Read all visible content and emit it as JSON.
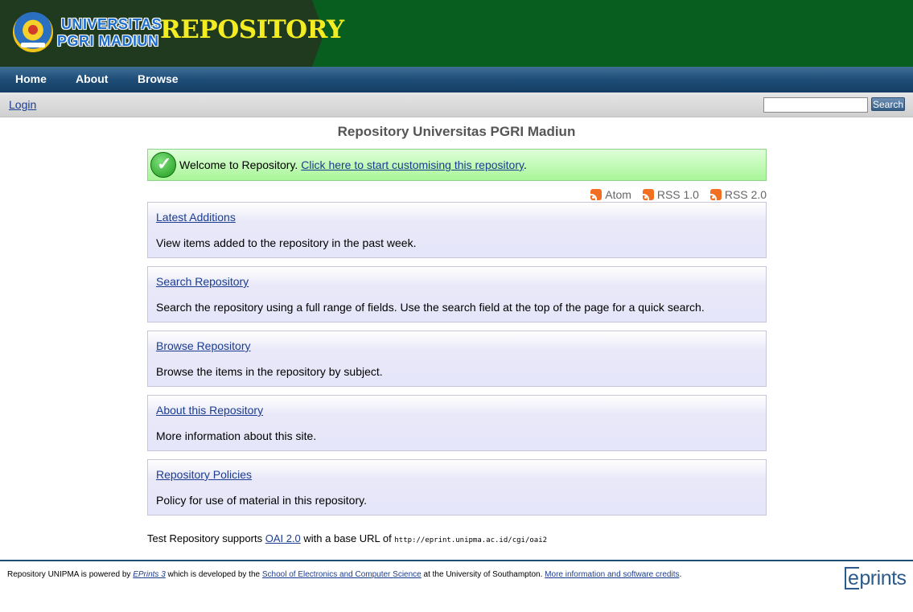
{
  "header": {
    "logo_line1": "UNIVERSITAS",
    "logo_line2": "PGRI MADIUN",
    "logo_seal_text": "UNIPMA",
    "site_title": "REPOSITORY"
  },
  "nav": {
    "items": [
      {
        "label": "Home"
      },
      {
        "label": "About"
      },
      {
        "label": "Browse"
      }
    ]
  },
  "toolbar": {
    "login_label": "Login",
    "search_value": "",
    "search_button_label": "Search"
  },
  "main": {
    "title": "Repository Universitas PGRI Madiun",
    "welcome_text": "Welcome to Repository.",
    "welcome_link": "Click here to start customising this repository",
    "welcome_trailing": ".",
    "feeds": [
      {
        "label": "Atom",
        "icon": "rss-icon"
      },
      {
        "label": "RSS 1.0",
        "icon": "rss-icon"
      },
      {
        "label": "RSS 2.0",
        "icon": "rss-icon"
      }
    ],
    "cards": [
      {
        "title": "Latest Additions",
        "description": "View items added to the repository in the past week."
      },
      {
        "title": "Search Repository",
        "description": "Search the repository using a full range of fields. Use the search field at the top of the page for a quick search."
      },
      {
        "title": "Browse Repository",
        "description": "Browse the items in the repository by subject."
      },
      {
        "title": "About this Repository",
        "description": "More information about this site."
      },
      {
        "title": "Repository Policies",
        "description": "Policy for use of material in this repository."
      }
    ],
    "oai": {
      "prefix": "Test Repository supports",
      "link": "OAI 2.0",
      "middle": "with a base URL of",
      "url": "http://eprint.unipma.ac.id/cgi/oai2"
    }
  },
  "footer": {
    "text1": "Repository UNIPMA is powered by",
    "eprints_link": "EPrints 3",
    "text2": "which is developed by the",
    "school_link": "School of Electronics and Computer Science",
    "text3": "at the University of Southampton.",
    "credits_link": "More information and software credits",
    "text4": ".",
    "logo_e": "e",
    "logo_rest": "prints"
  },
  "colors": {
    "header_green": "#075e1e",
    "title_yellow": "#f3ec23",
    "nav_blue": "#1e4d78",
    "link_blue": "#1b3d91"
  }
}
